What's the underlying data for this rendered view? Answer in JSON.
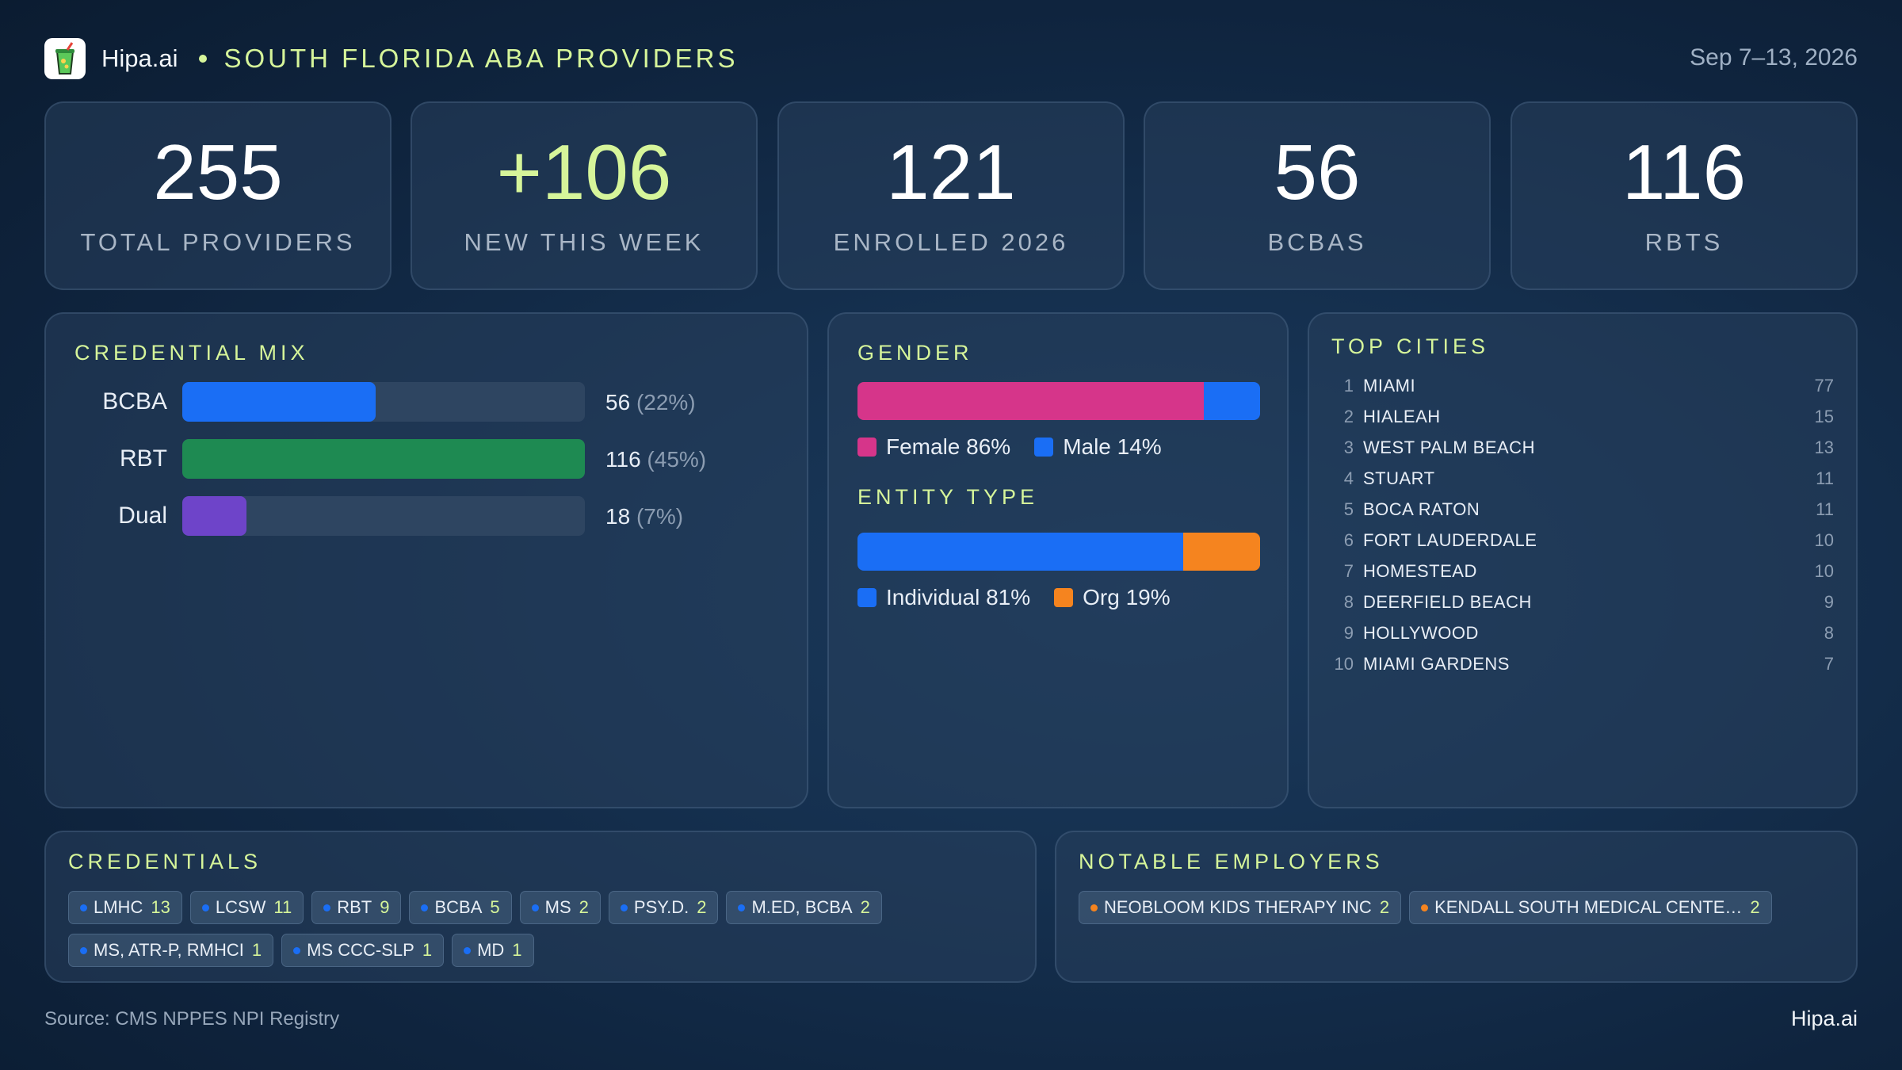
{
  "header": {
    "brand": "Hipa.ai",
    "title": "SOUTH FLORIDA ABA PROVIDERS",
    "date_range": "Sep 7–13, 2026",
    "logo_icon": "drink-cup-icon"
  },
  "kpis": [
    {
      "value": "255",
      "label": "TOTAL PROVIDERS"
    },
    {
      "value": "+106",
      "label": "NEW THIS WEEK"
    },
    {
      "value": "121",
      "label": "ENROLLED 2026"
    },
    {
      "value": "56",
      "label": "BCBAS"
    },
    {
      "value": "116",
      "label": "RBTS"
    }
  ],
  "credential_mix": {
    "title": "CREDENTIAL MIX",
    "rows": [
      {
        "name": "BCBA",
        "count": "56",
        "pct": "(22%)",
        "fraction": 0.48,
        "color": "#1a6ef5"
      },
      {
        "name": "RBT",
        "count": "116",
        "pct": "(45%)",
        "fraction": 1.0,
        "color": "#1e8a52"
      },
      {
        "name": "Dual",
        "count": "18",
        "pct": "(7%)",
        "fraction": 0.16,
        "color": "#6e44c9"
      }
    ]
  },
  "gender": {
    "title": "GENDER",
    "segments": [
      {
        "label": "Female 86%",
        "fraction": 0.86,
        "color": "#d6358a"
      },
      {
        "label": "Male 14%",
        "fraction": 0.14,
        "color": "#1a6ef5"
      }
    ]
  },
  "entity_type": {
    "title": "ENTITY TYPE",
    "segments": [
      {
        "label": "Individual 81%",
        "fraction": 0.81,
        "color": "#1a6ef5"
      },
      {
        "label": "Org 19%",
        "fraction": 0.19,
        "color": "#f5841f"
      }
    ]
  },
  "top_cities": {
    "title": "TOP CITIES",
    "rows": [
      {
        "rank": "1",
        "name": "MIAMI",
        "count": "77"
      },
      {
        "rank": "2",
        "name": "HIALEAH",
        "count": "15"
      },
      {
        "rank": "3",
        "name": "WEST PALM BEACH",
        "count": "13"
      },
      {
        "rank": "4",
        "name": "STUART",
        "count": "11"
      },
      {
        "rank": "5",
        "name": "BOCA RATON",
        "count": "11"
      },
      {
        "rank": "6",
        "name": "FORT LAUDERDALE",
        "count": "10"
      },
      {
        "rank": "7",
        "name": "HOMESTEAD",
        "count": "10"
      },
      {
        "rank": "8",
        "name": "DEERFIELD BEACH",
        "count": "9"
      },
      {
        "rank": "9",
        "name": "HOLLYWOOD",
        "count": "8"
      },
      {
        "rank": "10",
        "name": "MIAMI GARDENS",
        "count": "7"
      }
    ]
  },
  "credentials": {
    "title": "CREDENTIALS",
    "dot_color": "#1a6ef5",
    "chips": [
      {
        "name": "LMHC",
        "count": "13"
      },
      {
        "name": "LCSW",
        "count": "11"
      },
      {
        "name": "RBT",
        "count": "9"
      },
      {
        "name": "BCBA",
        "count": "5"
      },
      {
        "name": "MS",
        "count": "2"
      },
      {
        "name": "PSY.D.",
        "count": "2"
      },
      {
        "name": "M.ED, BCBA",
        "count": "2"
      },
      {
        "name": "MS, ATR-P, RMHCI",
        "count": "1"
      },
      {
        "name": "MS CCC-SLP",
        "count": "1"
      },
      {
        "name": "MD",
        "count": "1"
      }
    ]
  },
  "employers": {
    "title": "NOTABLE EMPLOYERS",
    "dot_color": "#f5841f",
    "chips": [
      {
        "name": "NEOBLOOM KIDS THERAPY INC",
        "count": "2"
      },
      {
        "name": "KENDALL SOUTH MEDICAL CENTE…",
        "count": "2"
      }
    ]
  },
  "footer": {
    "source": "Source: CMS NPPES NPI Registry",
    "brand": "Hipa.ai"
  }
}
